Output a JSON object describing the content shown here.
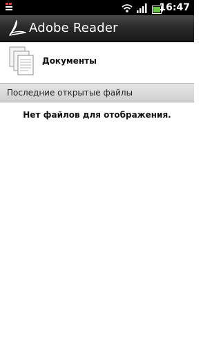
{
  "status_bar": {
    "time": "16:47",
    "icons": [
      "notification-icon",
      "wifi-icon",
      "signal-icon",
      "battery-icon"
    ]
  },
  "app_bar": {
    "title": "Adobe Reader",
    "logo_icon": "adobe-reader-logo-icon"
  },
  "documents": {
    "label": "Документы",
    "icon": "documents-stack-icon"
  },
  "recent_files": {
    "header": "Последние открытые файлы",
    "empty_message": "Нет файлов для отображения."
  },
  "colors": {
    "status_bar_bg": "#000000",
    "app_bar_bg": "#2a2a2a",
    "section_header_bg": "#dcdcdc",
    "battery_accent": "#6cc24a"
  }
}
